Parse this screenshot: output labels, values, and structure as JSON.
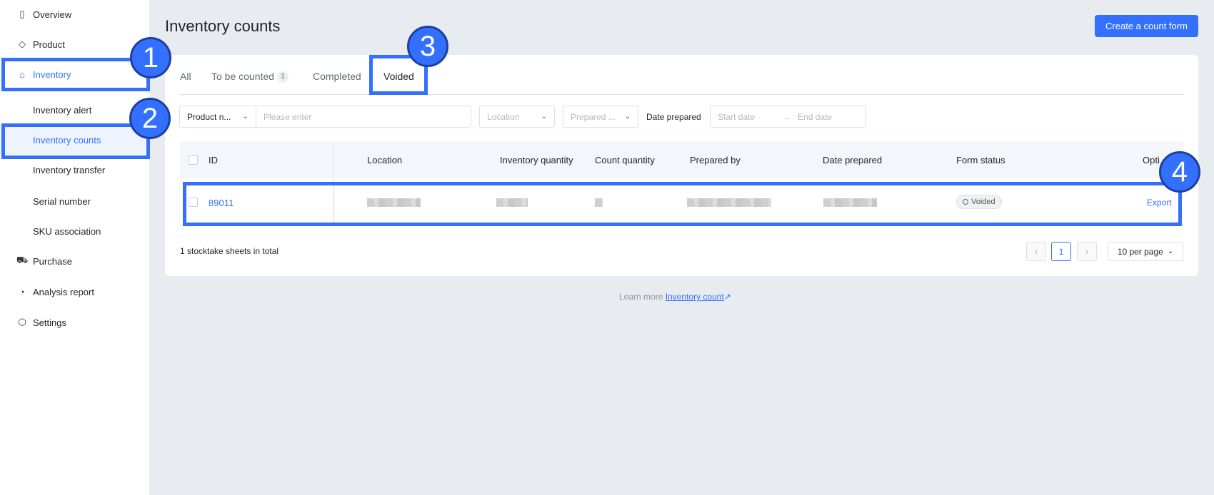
{
  "sidebar": {
    "items": [
      {
        "label": "Overview",
        "icon": "layout-icon"
      },
      {
        "label": "Product",
        "icon": "tag-icon"
      },
      {
        "label": "Inventory",
        "icon": "house-icon"
      },
      {
        "label": "Inventory alert"
      },
      {
        "label": "Inventory counts"
      },
      {
        "label": "Inventory transfer"
      },
      {
        "label": "Serial number"
      },
      {
        "label": "SKU association"
      },
      {
        "label": "Purchase",
        "icon": "cart-icon"
      },
      {
        "label": "Analysis report",
        "icon": "pie-chart-icon"
      },
      {
        "label": "Settings",
        "icon": "hexagon-gear-icon"
      }
    ]
  },
  "header": {
    "title": "Inventory counts",
    "create_button": "Create a count form"
  },
  "tabs": [
    {
      "label": "All"
    },
    {
      "label": "To be counted",
      "badge": "1"
    },
    {
      "label": "Completed"
    },
    {
      "label": "Voided",
      "active": true
    }
  ],
  "filters": {
    "product_select": "Product n...",
    "search_placeholder": "Please enter",
    "location": "Location",
    "prepared_by": "Prepared ...",
    "date_label": "Date prepared",
    "start_placeholder": "Start date",
    "end_placeholder": "End date"
  },
  "table": {
    "columns": [
      "ID",
      "Location",
      "Inventory quantity",
      "Count quantity",
      "Prepared by",
      "Date prepared",
      "Form status",
      "Opti"
    ],
    "rows": [
      {
        "id": "89011",
        "status": "Voided",
        "action": "Export"
      }
    ]
  },
  "footer": {
    "total": "1 stocktake sheets in total",
    "page": "1",
    "per_page": "10 per page"
  },
  "learn_more": {
    "text": "Learn more",
    "link": "Inventory count"
  },
  "annotations": [
    "1",
    "2",
    "3",
    "4"
  ],
  "colors": {
    "accent": "#3370ff",
    "background": "#e8ebf0"
  }
}
